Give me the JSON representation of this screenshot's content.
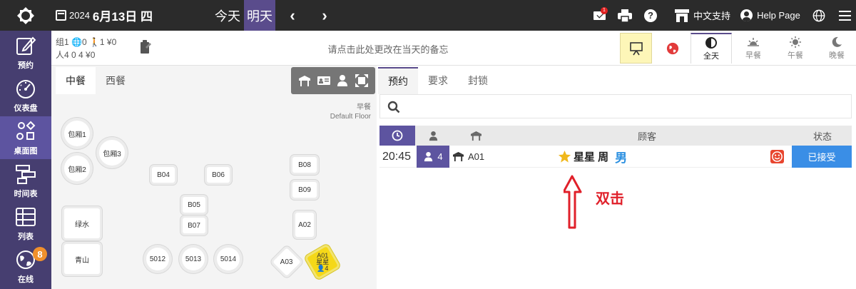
{
  "header": {
    "year": "2024",
    "date": "6月13日 四",
    "today_label": "今天",
    "tomorrow_label": "明天",
    "mail_badge": "1",
    "support_label": "中文支持",
    "help_label": "Help Page"
  },
  "sidebar": {
    "items": [
      {
        "label": "预约",
        "icon": "edit-icon"
      },
      {
        "label": "仪表盘",
        "icon": "gauge-icon"
      },
      {
        "label": "桌面图",
        "icon": "shapes-icon"
      },
      {
        "label": "时间表",
        "icon": "timeline-icon"
      },
      {
        "label": "列表",
        "icon": "table-icon"
      },
      {
        "label": "在线",
        "icon": "globe-icon",
        "badge": "8"
      }
    ]
  },
  "stats": {
    "row1": "组1 🌐0 🚶1 ¥0",
    "row2": "人4   0   4 ¥0"
  },
  "note": {
    "text": "请点击此处更改在当天的备忘"
  },
  "meals": [
    {
      "label": "全天",
      "icon": "half-circle-icon"
    },
    {
      "label": "早餐",
      "icon": "sunrise-icon"
    },
    {
      "label": "午餐",
      "icon": "sun-icon"
    },
    {
      "label": "晚餐",
      "icon": "moon-icon"
    }
  ],
  "floor": {
    "tabs": [
      "中餐",
      "西餐"
    ],
    "label_meal": "早餐",
    "label_floor": "Default Floor",
    "tables": {
      "r1": "包厢1",
      "r2": "包厢2",
      "r3": "包厢3",
      "b04": "B04",
      "b06": "B06",
      "b05": "B05",
      "b07": "B07",
      "b08": "B08",
      "b09": "B09",
      "a02": "A02",
      "a03": "A03",
      "lvshui": "绿水",
      "qingshan": "青山",
      "t5012": "5012",
      "t5013": "5013",
      "t5014": "5014",
      "a01": "A01",
      "a01_guest": "星星",
      "a01_count": "4"
    }
  },
  "reservations": {
    "tabs": [
      "预约",
      "要求",
      "封锁"
    ],
    "search_value": "",
    "columns": {
      "guest": "顾客",
      "status": "状态"
    },
    "rows": [
      {
        "time": "20:45",
        "people": "4",
        "table": "A01",
        "guest": "星星 周",
        "sex": "男",
        "status": "已接受"
      }
    ]
  },
  "annotation": {
    "text": "双击"
  },
  "colors": {
    "topbar": "#2b2b2b",
    "sidebar": "#463e70",
    "accent": "#5a4c8c",
    "status_blue": "#3a8ee6",
    "selected_table": "#f5d818",
    "annotation_red": "#e0202a"
  }
}
